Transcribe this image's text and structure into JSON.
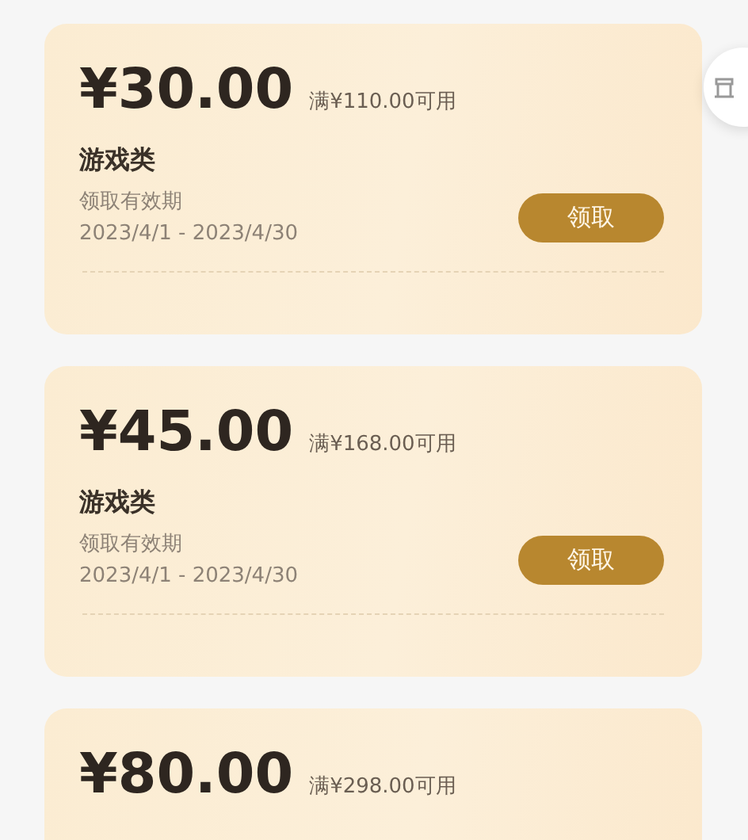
{
  "coupons": [
    {
      "amount": "¥30.00",
      "condition": "满¥110.00可用",
      "category": "游戏类",
      "validity_label": "领取有效期",
      "validity": "2023/4/1 - 2023/4/30",
      "button": "领取"
    },
    {
      "amount": "¥45.00",
      "condition": "满¥168.00可用",
      "category": "游戏类",
      "validity_label": "领取有效期",
      "validity": "2023/4/1 - 2023/4/30",
      "button": "领取"
    },
    {
      "amount": "¥80.00",
      "condition": "满¥298.00可用"
    }
  ]
}
